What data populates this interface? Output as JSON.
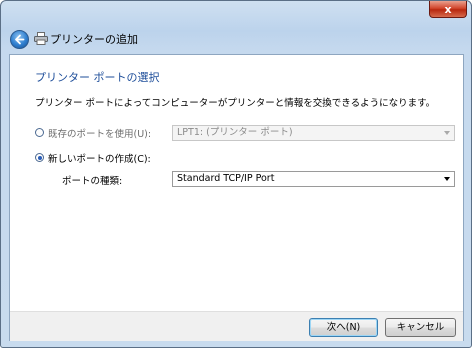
{
  "window": {
    "title": "プリンターの追加",
    "close_glyph": "x"
  },
  "page": {
    "heading": "プリンター ポートの選択",
    "description": "プリンター ポートによってコンピューターがプリンターと情報を交換できるようになります。"
  },
  "options": {
    "existing": {
      "label": "既存のポートを使用(U):",
      "value": "LPT1: (プリンター ポート)",
      "selected": false
    },
    "new": {
      "label": "新しいポートの作成(C):",
      "selected": true
    },
    "port_type": {
      "label": "ポートの種類:",
      "value": "Standard TCP/IP Port"
    }
  },
  "buttons": {
    "next": "次へ(N)",
    "cancel": "キャンセル"
  },
  "colors": {
    "heading": "#1e4e9a",
    "accent": "#2a5db8"
  }
}
